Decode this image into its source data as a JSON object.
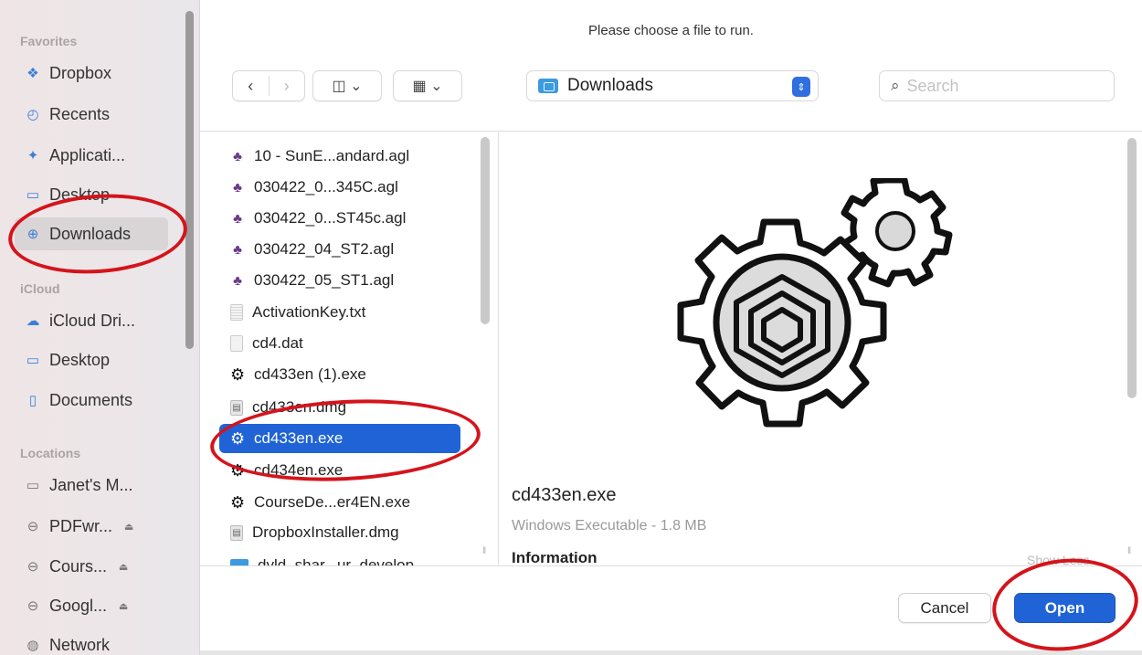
{
  "dialog": {
    "title": "Please choose a file to run."
  },
  "sidebar": {
    "sections": [
      {
        "label": "Favorites"
      },
      {
        "label": "iCloud"
      },
      {
        "label": "Locations"
      }
    ],
    "items": [
      {
        "label": "Dropbox",
        "icon": "dropbox-icon"
      },
      {
        "label": "Recents",
        "icon": "clock-icon"
      },
      {
        "label": "Applicati...",
        "icon": "applications-icon"
      },
      {
        "label": "Desktop",
        "icon": "desktop-icon"
      },
      {
        "label": "Downloads",
        "icon": "download-icon",
        "selected": true
      },
      {
        "label": "iCloud Dri...",
        "icon": "cloud-icon"
      },
      {
        "label": "Desktop",
        "icon": "desktop-icon"
      },
      {
        "label": "Documents",
        "icon": "document-icon"
      },
      {
        "label": "Janet's M...",
        "icon": "laptop-icon"
      },
      {
        "label": "PDFwr...",
        "icon": "drive-icon",
        "eject": true
      },
      {
        "label": "Cours...",
        "icon": "drive-icon",
        "eject": true
      },
      {
        "label": "Googl...",
        "icon": "drive-icon",
        "eject": true
      },
      {
        "label": "Network",
        "icon": "network-icon"
      }
    ]
  },
  "toolbar": {
    "back": "‹",
    "forward": "›",
    "view_columns": "◫ ⌄",
    "view_grid": "▦ ⌄",
    "location": "Downloads",
    "search_placeholder": "Search"
  },
  "files": [
    {
      "name": "10 - SunE...andard.agl",
      "type": "agl"
    },
    {
      "name": "030422_0...345C.agl",
      "type": "agl"
    },
    {
      "name": "030422_0...ST45c.agl",
      "type": "agl"
    },
    {
      "name": "030422_04_ST2.agl",
      "type": "agl"
    },
    {
      "name": "030422_05_ST1.agl",
      "type": "agl"
    },
    {
      "name": "ActivationKey.txt",
      "type": "txt"
    },
    {
      "name": "cd4.dat",
      "type": "doc"
    },
    {
      "name": "cd433en (1).exe",
      "type": "exe"
    },
    {
      "name": "cd433en.dmg",
      "type": "dmg"
    },
    {
      "name": "cd433en.exe",
      "type": "exe",
      "selected": true
    },
    {
      "name": "cd434en.exe",
      "type": "exe"
    },
    {
      "name": "CourseDe...er4EN.exe",
      "type": "exe"
    },
    {
      "name": "DropboxInstaller.dmg",
      "type": "dmg"
    },
    {
      "name": "dyld_shar...ur_develop...",
      "type": "folder"
    }
  ],
  "preview": {
    "filename": "cd433en.exe",
    "kind": "Windows Executable - 1.8 MB",
    "info_heading": "Information",
    "show_less": "Show Less",
    "icon": "executable-gear-icon"
  },
  "buttons": {
    "cancel": "Cancel",
    "open": "Open"
  },
  "colors": {
    "accent": "#1f63d6",
    "annotation": "#d4141b"
  }
}
